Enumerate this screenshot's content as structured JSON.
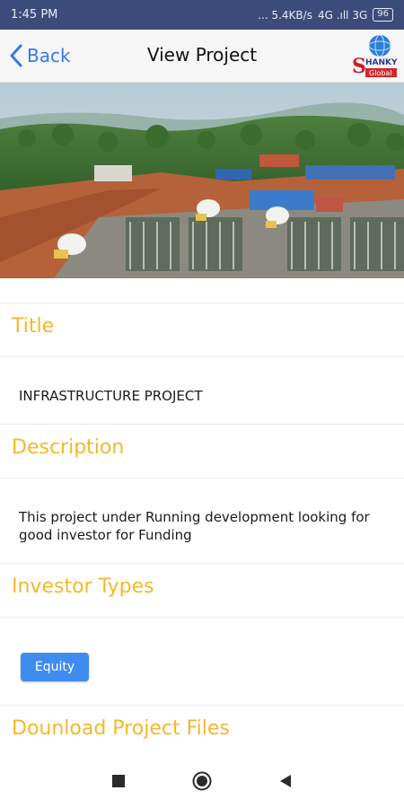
{
  "status_bar": {
    "time": "1:45 PM",
    "network": "... 5.4KB/s",
    "signal": "4G .ıll 3G",
    "battery": "96"
  },
  "header": {
    "back_label": "Back",
    "title": "View Project",
    "logo_text_top": "HANKY",
    "logo_text_bottom": "Global",
    "logo_letter": "S"
  },
  "hero": {
    "image": "construction-site-photo"
  },
  "sections": {
    "title_heading": "Title",
    "title_value": "INFRASTRUCTURE PROJECT",
    "description_heading": "Description",
    "description_value": "This project under Running development looking for good investor for Funding",
    "investor_heading": "Investor Types",
    "investor_types": [
      "Equity"
    ],
    "download_heading": "Dounload Project Files"
  },
  "colors": {
    "accent": "#f3b82c",
    "link_blue": "#3579ea",
    "badge_blue": "#3f8cf0",
    "status_bar": "#3b4b7a"
  },
  "nav": {
    "icons": [
      "recent-apps-icon",
      "home-icon",
      "back-triangle-icon"
    ]
  }
}
